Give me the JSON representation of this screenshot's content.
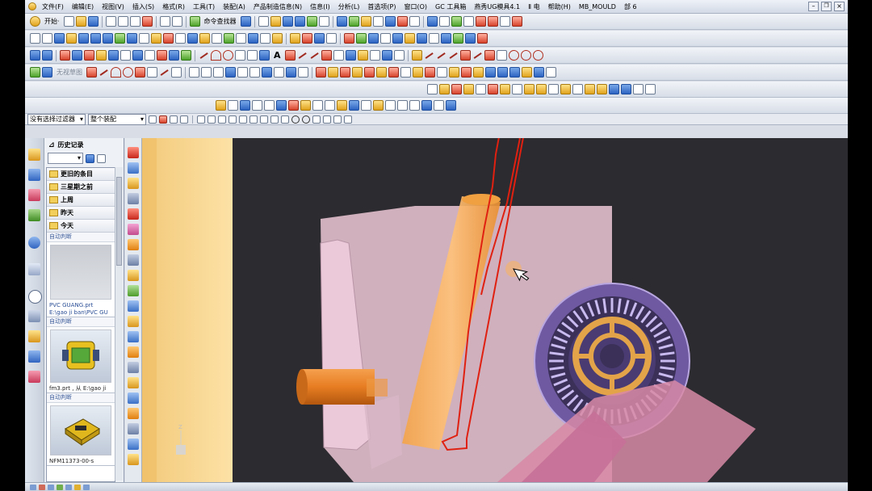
{
  "menubar": {
    "items": [
      "文件(F)",
      "编辑(E)",
      "视图(V)",
      "插入(S)",
      "格式(R)",
      "工具(T)",
      "装配(A)",
      "产品制造信息(N)",
      "信息(I)",
      "分析(L)",
      "首选项(P)",
      "窗口(O)",
      "GC 工具箱",
      "燕秀UG模具4.1",
      "Ⅱ 电",
      "帮助(H)",
      "MB_MOULD",
      "部 6"
    ]
  },
  "toolbar1": {
    "start_label": "开始·",
    "command_finder": "命令查找器"
  },
  "toolbar4": {
    "sketch_label": "无视草图"
  },
  "filterbar": {
    "filter_value": "没有选择过滤器",
    "assembly_value": "整个装配"
  },
  "history_panel": {
    "title": "历史记录",
    "groups": [
      "更旧的条目",
      "三星期之前",
      "上周",
      "昨天",
      "今天"
    ],
    "tiles": [
      {
        "header": "自动判断",
        "caption": "PVC GUANG.prt",
        "path": "E:\\gao ji ban\\PVC GU"
      },
      {
        "header": "自动判断",
        "caption": "fm3.prt , 从 E:\\gao ji",
        "path": ""
      },
      {
        "header": "自动判断",
        "caption": "NFM11373-00-s",
        "path": ""
      }
    ]
  },
  "viewport": {
    "triad_axis_label": "Z",
    "colors": {
      "background": "#2c2b2f",
      "plate": "#cfb0bc",
      "cylinder": "#f0a040",
      "sketch_curve": "#e02010",
      "gear": "#e3a449"
    }
  }
}
